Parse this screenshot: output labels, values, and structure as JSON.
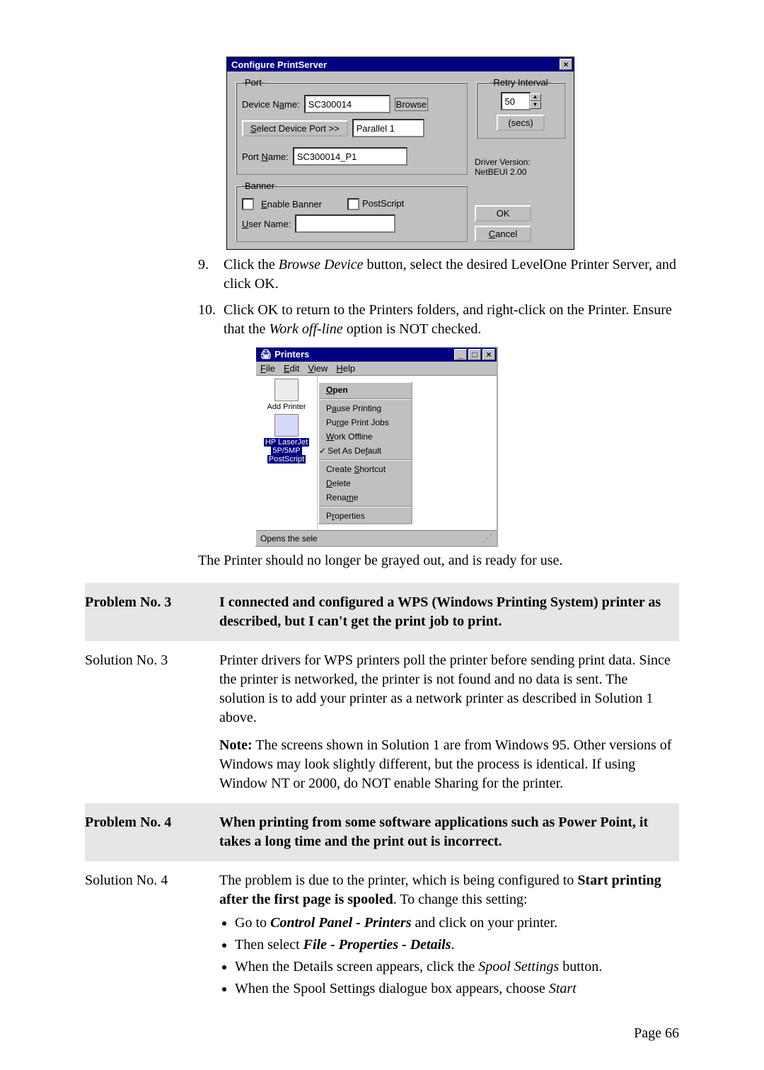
{
  "dialog1": {
    "title": "Configure PrintServer",
    "port_legend": "Port",
    "device_name_label": "Device Name:",
    "device_name_value": "SC300014",
    "browse_btn": "Browse",
    "select_port_btn": "Select Device Port >>",
    "select_port_value": "Parallel 1",
    "port_name_label": "Port Name:",
    "port_name_value": "SC300014_P1",
    "retry_legend": "Retry Interval",
    "retry_value": "50",
    "retry_secs": "(secs)",
    "driver1": "Driver Version:",
    "driver2": "NetBEUI  2.00",
    "banner_legend": "Banner",
    "enable_banner": "Enable Banner",
    "postscript": "PostScript",
    "user_name_label": "User Name:",
    "ok": "OK",
    "cancel": "Cancel"
  },
  "step9": {
    "num": "9.",
    "a": "Click the ",
    "b": "Browse Device",
    "c": " button, select the desired LevelOne Printer Server, and click OK."
  },
  "step10": {
    "num": "10.",
    "a": "Click OK to return to the Printers folders, and right-click on the Printer. Ensure that the ",
    "b": "Work off-line",
    "c": " option is NOT checked."
  },
  "printers": {
    "title": "Printers",
    "menu": {
      "file": "File",
      "edit": "Edit",
      "view": "View",
      "help": "Help"
    },
    "addprinter": "Add Printer",
    "sel1": "HP LaserJet",
    "sel2": "5P/5MP",
    "sel3": "PostScript",
    "ctx": {
      "open": "Open",
      "pause": "Pause Printing",
      "purge": "Purge Print Jobs",
      "work": "Work Offline",
      "setdef": "Set As Default",
      "shortcut": "Create Shortcut",
      "delete": "Delete",
      "rename": "Rename",
      "props": "Properties"
    },
    "status": "Opens the sele"
  },
  "after_printers": "The Printer should no longer be grayed out, and is ready for use.",
  "p3": {
    "label": "Problem No. 3",
    "text": "I connected and configured a WPS (Windows Printing System) printer as described, but I can't get the print job to print."
  },
  "s3": {
    "label": "Solution No. 3",
    "para1": "Printer drivers for WPS printers poll the printer before sending print data. Since the printer is networked, the printer is not found and no data is sent. The solution is to add your printer as a network printer as described in Solution 1 above.",
    "noteB": "Note:",
    "note": " The screens shown in Solution 1 are from Windows 95. Other versions of Windows may look slightly different, but the process is identical. If using Window NT or 2000, do NOT enable Sharing for the printer."
  },
  "p4": {
    "label": "Problem No. 4",
    "text": "When printing from some software applications such as Power Point, it takes a long time and the print out is incorrect."
  },
  "s4": {
    "label": "Solution No. 4",
    "a": "The problem is due to the printer, which is being configured to ",
    "startB": "Start printing after the first page is spooled",
    "b": ". To change this setting:",
    "li1a": "Go to ",
    "li1i": "Control Panel - Printers",
    "li1b": " and click on your printer.",
    "li2a": "Then select ",
    "li2i": "File - Properties - Details",
    "li2b": ".",
    "li3a": "When the Details screen appears, click the ",
    "li3i": "Spool Settings",
    "li3b": " button.",
    "li4a": "When the Spool Settings dialogue box appears, choose ",
    "li4i": "Start"
  },
  "pagenum": "Page 66"
}
